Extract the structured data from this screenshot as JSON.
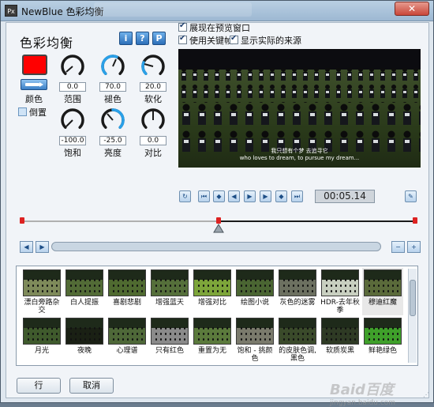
{
  "window": {
    "title": "NewBlue 色彩均衡",
    "icon_text": "Px",
    "close": "✕"
  },
  "header": {
    "title": "色彩均衡",
    "btn_info": "i",
    "btn_help": "?",
    "btn_preset": "P"
  },
  "color": {
    "label": "颜色",
    "value": "#ff0000",
    "invert_label": "倒置"
  },
  "knobs": [
    {
      "label": "范围",
      "value": "0.0"
    },
    {
      "label": "褪色",
      "value": "70.0"
    },
    {
      "label": "软化",
      "value": "20.0"
    },
    {
      "label": "饱和",
      "value": "-100.0"
    },
    {
      "label": "亮度",
      "value": "-25.0"
    },
    {
      "label": "对比",
      "value": "0.0"
    }
  ],
  "options": {
    "show_preview": "展现在预览窗口",
    "use_keyframes": "使用关键帧",
    "show_source": "显示实际的来源"
  },
  "preview": {
    "subtitle_cn": "我只想有个梦 去追寻它",
    "subtitle_en": "who loves to dream, to pursue my dream..."
  },
  "transport": {
    "timecode": "00:05.14"
  },
  "presets": [
    [
      "漂白旁路杂交",
      "白人提振",
      "喜剧悲剧",
      "增强蓝天",
      "增强对比",
      "绘图小说",
      "灰色的迷雾",
      "HDR-去年秋季",
      "穆迪红魔"
    ],
    [
      "月光",
      "夜晚",
      "心理谱",
      "只有红色",
      "重置为无",
      "饱和 - 挑颜色",
      "的皮肤色调, 黑色",
      "软质炭黑",
      "鲜艳绿色"
    ]
  ],
  "buttons": {
    "ok": "行",
    "cancel": "取消"
  },
  "watermark": {
    "main": "Baid百度",
    "sub": "jingyan.baidu.com"
  }
}
